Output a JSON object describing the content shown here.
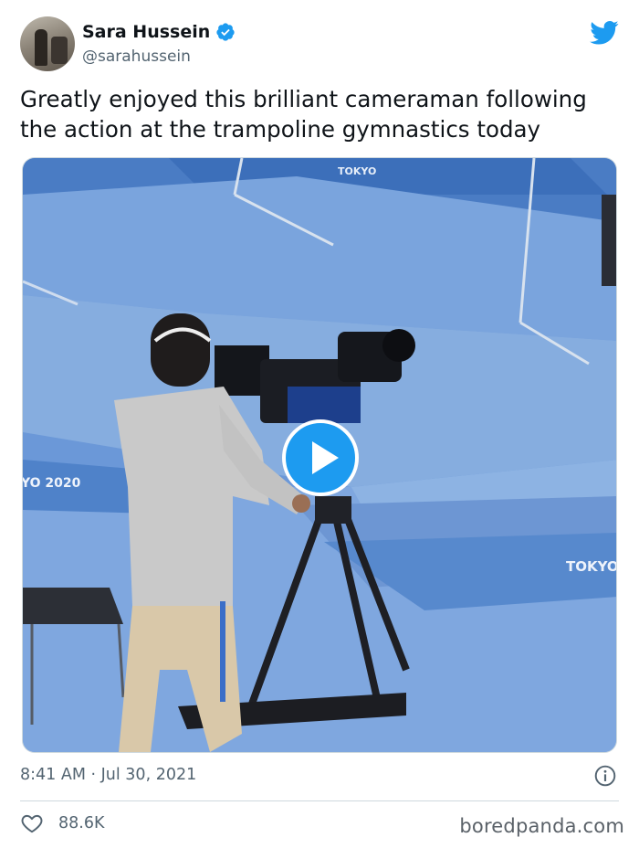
{
  "author": {
    "name": "Sara Hussein",
    "handle": "@sarahussein",
    "verified": true
  },
  "tweet": {
    "text": "Greatly enjoyed this brilliant cameraman following the action at the trampoline gymnastics today",
    "media": {
      "type": "video",
      "signage": [
        "TOKYO",
        "YO 2020",
        "TOKYO"
      ]
    },
    "timestamp": "8:41 AM · Jul 30, 2021",
    "likes": "88.6K"
  },
  "icons": {
    "verified": "verified-badge-icon",
    "brand": "twitter-bird-icon",
    "play": "play-icon",
    "info": "info-icon",
    "like": "heart-icon"
  },
  "colors": {
    "twitter_blue": "#1d9bf0",
    "secondary_text": "#536471",
    "mat_blue": "#5a8ed1"
  },
  "watermark": "boredpanda.com"
}
